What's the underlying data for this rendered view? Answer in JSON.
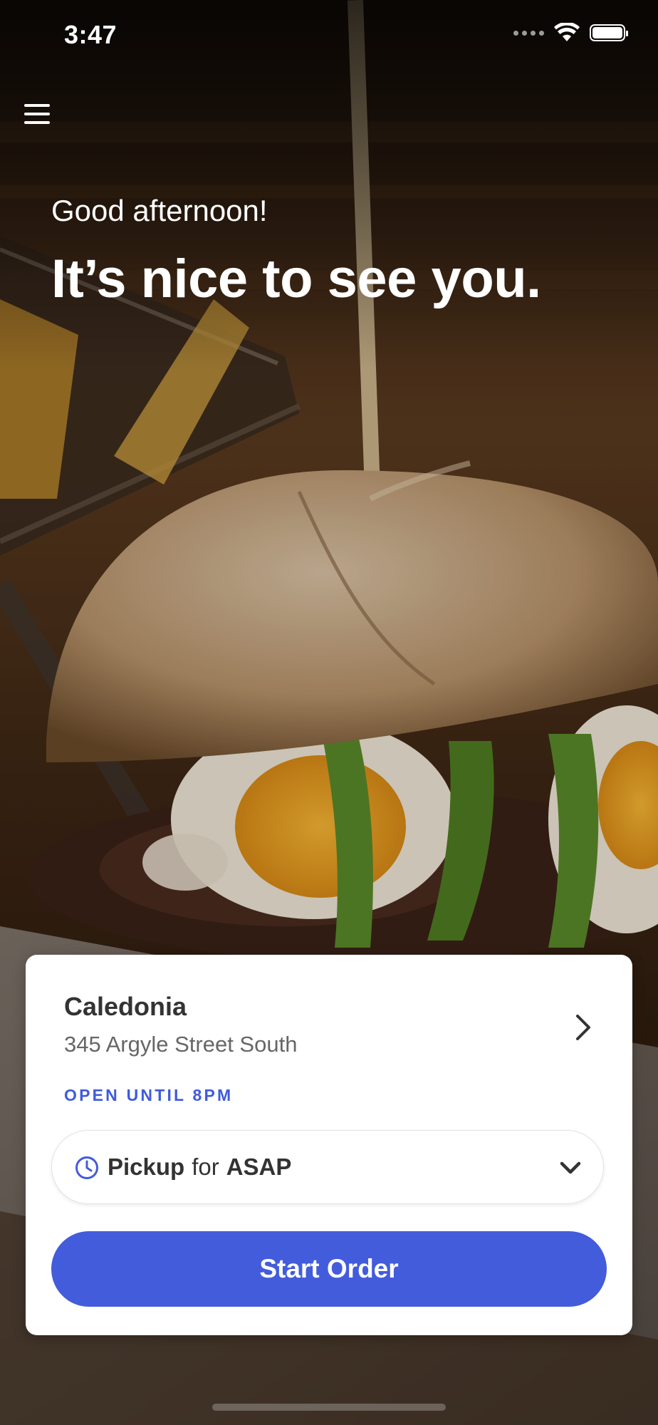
{
  "status_bar": {
    "time": "3:47"
  },
  "greeting": {
    "subtitle": "Good afternoon!",
    "title": "It’s nice to see you."
  },
  "location": {
    "name": "Caledonia",
    "address": "345 Argyle Street South",
    "status": "OPEN UNTIL 8PM"
  },
  "order_mode": {
    "method": "Pickup",
    "connector": "for",
    "time": "ASAP"
  },
  "cta": {
    "label": "Start Order"
  },
  "colors": {
    "accent": "#435cdc",
    "status_blue": "#3f5bdc"
  },
  "icons": {
    "menu": "hamburger-menu-icon",
    "chevron": "chevron-right-icon",
    "clock": "clock-icon",
    "dropdown": "chevron-down-icon"
  }
}
